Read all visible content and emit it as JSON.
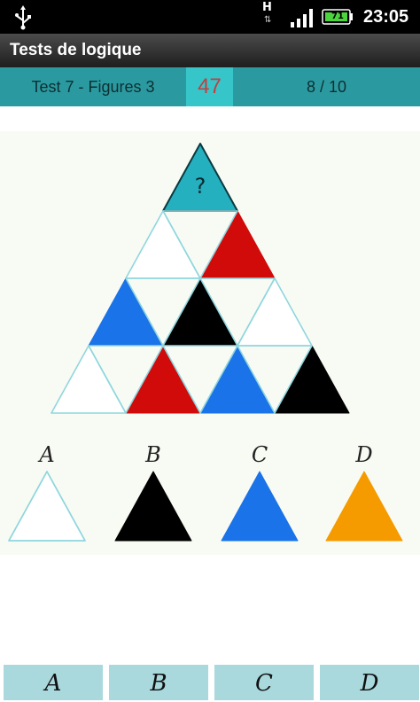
{
  "statusbar": {
    "network": "H",
    "battery": "71",
    "time": "23:05"
  },
  "app": {
    "title": "Tests de logique"
  },
  "info": {
    "test_name": "Test 7 - Figures 3",
    "score": "47",
    "progress": "8 / 10"
  },
  "puzzle": {
    "unknown_mark": "?",
    "rows": [
      [
        "teal"
      ],
      [
        "white",
        "red"
      ],
      [
        "blue",
        "black",
        "white"
      ],
      [
        "white",
        "red",
        "blue",
        "black"
      ]
    ]
  },
  "options": [
    {
      "letter": "A",
      "color": "white"
    },
    {
      "letter": "B",
      "color": "black"
    },
    {
      "letter": "C",
      "color": "blue"
    },
    {
      "letter": "D",
      "color": "orange"
    }
  ],
  "answer_buttons": [
    "A",
    "B",
    "C",
    "D"
  ],
  "colors": {
    "teal": "#25b0bf",
    "red": "#d10a0a",
    "blue": "#1a73e8",
    "black": "#000000",
    "orange": "#f59b00",
    "white": "#ffffff",
    "outline": "#8fd6de",
    "accent_bar": "#2b9aa0",
    "button": "#a9d9dd"
  }
}
